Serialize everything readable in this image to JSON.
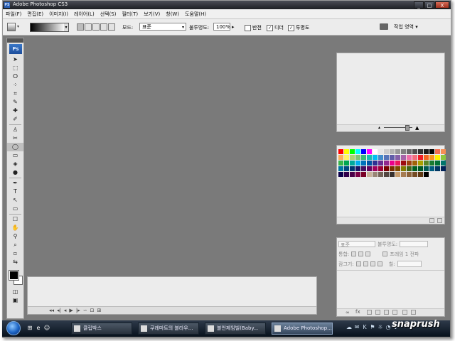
{
  "window": {
    "title": "Adobe Photoshop CS3",
    "app_icon": "PS",
    "controls": {
      "minimize": "_",
      "maximize": "□",
      "close": "X"
    }
  },
  "menu": [
    "파일(F)",
    "편집(E)",
    "이미지(I)",
    "레이어(L)",
    "선택(S)",
    "필터(T)",
    "보기(V)",
    "창(W)",
    "도움말(H)"
  ],
  "options_bar": {
    "mode_label": "모드:",
    "mode_value": "표준",
    "opacity_label": "불투명도:",
    "opacity_value": "100%",
    "reverse_label": "반전",
    "dither_label": "디더",
    "transparency_label": "투명도",
    "dither_checked": "✓",
    "transparency_checked": "✓",
    "workspace_label": "작업 영역 ▾"
  },
  "toolbox": {
    "logo": "Ps",
    "tools": [
      "➤",
      "⬚",
      "ⵔ",
      "⁘",
      "⌗",
      "✎",
      "✚",
      "✐",
      "♙",
      "✂",
      "◯",
      "▭",
      "◈",
      "●",
      "✒",
      "T",
      "↖",
      "▭",
      "☐",
      "✋",
      "⚲",
      "⌕",
      "▫",
      "⇆"
    ],
    "active_tool_index": 10,
    "foreground_color": "#000000",
    "background_color": "#ffffff"
  },
  "panels": {
    "layers": {
      "blend_mode": "표준",
      "opacity_label": "불투명도:",
      "lock_label": "잠그기:",
      "fill_label": "칠:",
      "unify_label": "통합:",
      "propagate_label": "프레임 1 전파"
    }
  },
  "swatches": [
    "#ff0000",
    "#ffff00",
    "#00ff00",
    "#00ffff",
    "#0000ff",
    "#ff00ff",
    "#ffffff",
    "#e6e6e6",
    "#cccccc",
    "#b3b3b3",
    "#999999",
    "#808080",
    "#666666",
    "#4d4d4d",
    "#333333",
    "#1a1a1a",
    "#000000",
    "#f26c4f",
    "#f68e55",
    "#fbaf5c",
    "#fff467",
    "#acd372",
    "#7cc576",
    "#3bb878",
    "#1abbb4",
    "#00bff3",
    "#438ccb",
    "#5574b9",
    "#605ca8",
    "#855fa8",
    "#a763a8",
    "#f06ea9",
    "#f26d7d",
    "#ed1c24",
    "#f26522",
    "#f7941d",
    "#fff200",
    "#8dc63f",
    "#39b54a",
    "#00a651",
    "#00a99d",
    "#00aeef",
    "#0072bc",
    "#0054a6",
    "#2e3192",
    "#662d91",
    "#92278f",
    "#ec008c",
    "#ed145b",
    "#9e0b0f",
    "#a0410d",
    "#a36209",
    "#aba000",
    "#598527",
    "#197b30",
    "#007236",
    "#00746b",
    "#0076a3",
    "#004a80",
    "#003471",
    "#1b1464",
    "#440e62",
    "#630460",
    "#9e005d",
    "#9e0039",
    "#790000",
    "#7b2e00",
    "#7d4900",
    "#827b00",
    "#406618",
    "#005e20",
    "#005826",
    "#005952",
    "#005b7f",
    "#003663",
    "#002157",
    "#0d004c",
    "#32004b",
    "#4b0049",
    "#7b0046",
    "#7a0026",
    "#c7b299",
    "#998675",
    "#736357",
    "#534741",
    "#37302d",
    "#c69c6d",
    "#a67c52",
    "#8c6239",
    "#754c24",
    "#603913",
    "#000000"
  ],
  "animation_controls": [
    "◂◂",
    "◂|",
    "◂",
    "▶",
    "|▸",
    "∽",
    "⊡",
    "⊞"
  ],
  "taskbar": {
    "quick_launch": [
      "⊞",
      "e",
      "☺"
    ],
    "tasks": [
      {
        "label": "클립박스",
        "active": false
      },
      {
        "label": "쿠레마트의 블라우...",
        "active": false
      },
      {
        "label": "블언제임빌(Baby...",
        "active": false
      },
      {
        "label": "Adobe Photoshop...",
        "active": true
      }
    ],
    "tray_icons": [
      "☁",
      "✉",
      "K",
      "⚑",
      "☼",
      "◔",
      "♪"
    ]
  },
  "watermark": "snaprush"
}
